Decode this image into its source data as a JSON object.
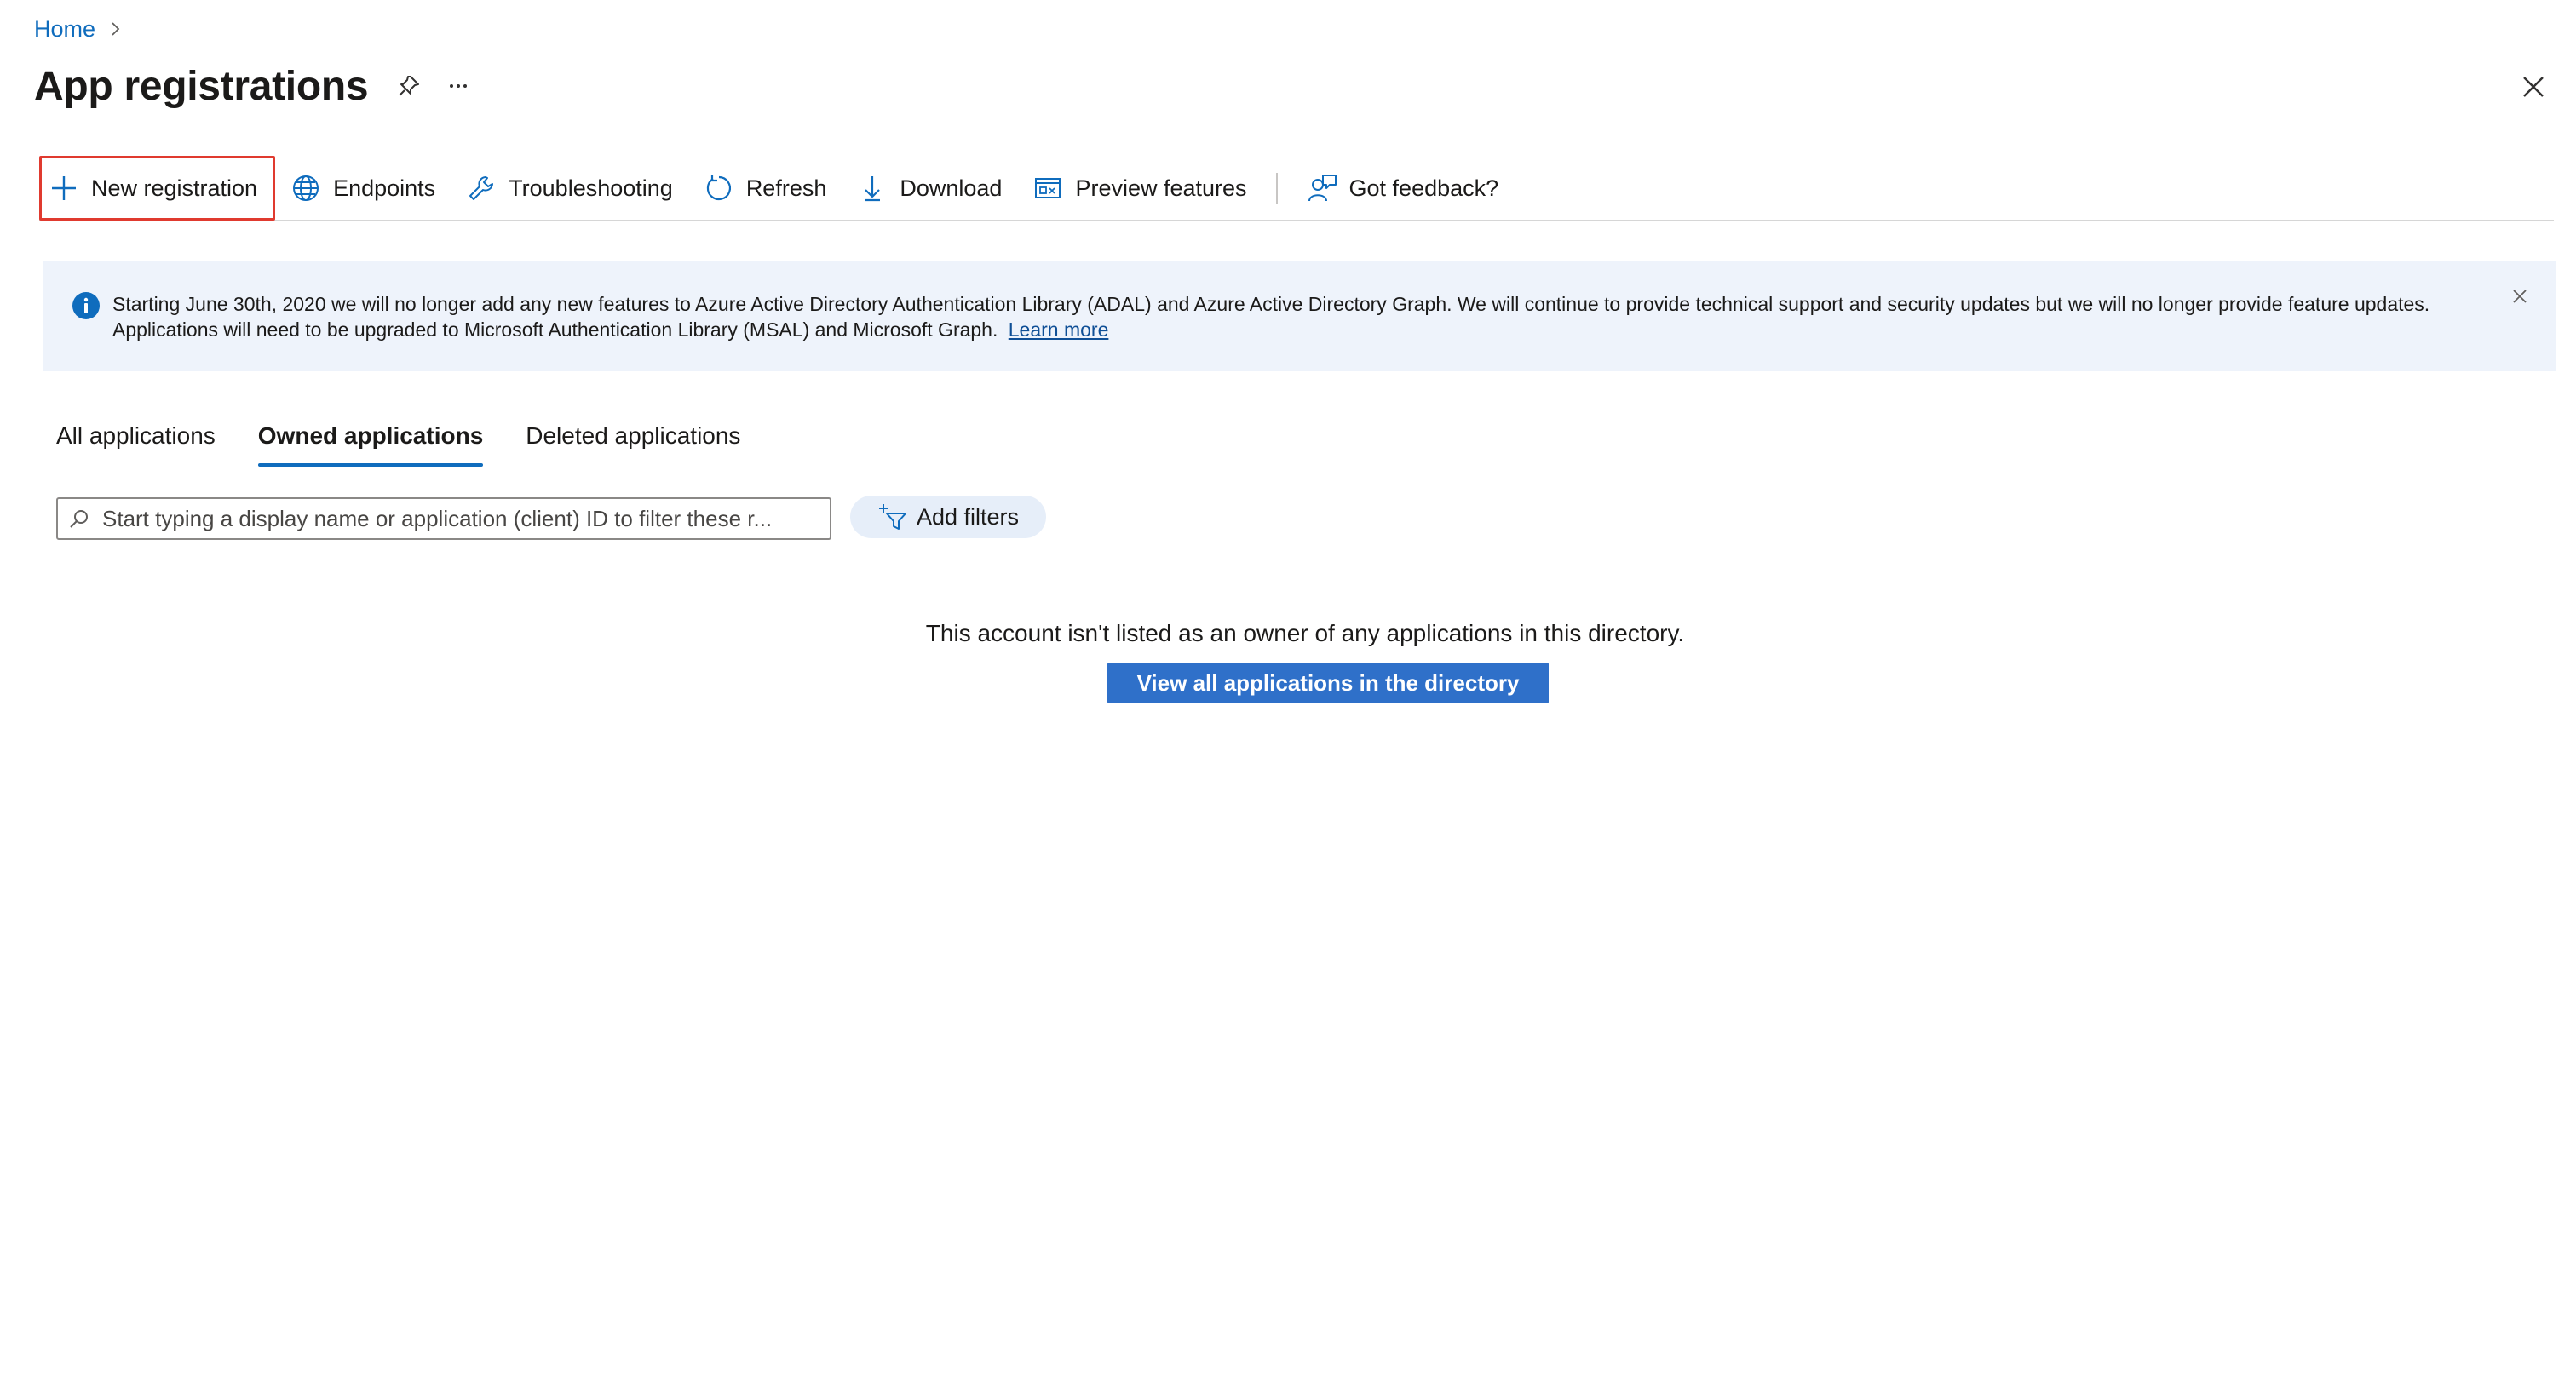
{
  "breadcrumb": {
    "home_label": "Home"
  },
  "header": {
    "title": "App registrations",
    "pin_icon": "pin-icon",
    "more_icon": "ellipsis-icon",
    "close_icon": "close-icon"
  },
  "toolbar": {
    "items": [
      {
        "label": "New registration",
        "icon": "plus-icon"
      },
      {
        "label": "Endpoints",
        "icon": "globe-icon"
      },
      {
        "label": "Troubleshooting",
        "icon": "wrench-icon"
      },
      {
        "label": "Refresh",
        "icon": "refresh-icon"
      },
      {
        "label": "Download",
        "icon": "download-icon"
      },
      {
        "label": "Preview features",
        "icon": "preview-icon"
      },
      {
        "label": "Got feedback?",
        "icon": "feedback-icon"
      }
    ],
    "highlight_color": "#e03a2f"
  },
  "banner": {
    "text": "Starting June 30th, 2020 we will no longer add any new features to Azure Active Directory Authentication Library (ADAL) and Azure Active Directory Graph. We will continue to provide technical support and security updates but we will no longer provide feature updates. Applications will need to be upgraded to Microsoft Authentication Library (MSAL) and Microsoft Graph.",
    "link_label": "Learn more",
    "icon": "info-icon",
    "background": "#eef3fb"
  },
  "tabs": [
    {
      "label": "All applications",
      "active": false
    },
    {
      "label": "Owned applications",
      "active": true
    },
    {
      "label": "Deleted applications",
      "active": false
    }
  ],
  "filter": {
    "search_placeholder": "Start typing a display name or application (client) ID to filter these r...",
    "search_value": "",
    "add_filters_label": "Add filters"
  },
  "empty_state": {
    "message": "This account isn't listed as an owner of any applications in this directory.",
    "button_label": "View all applications in the directory"
  },
  "colors": {
    "accent": "#0f6cbd",
    "primary_button": "#2f70c9"
  }
}
